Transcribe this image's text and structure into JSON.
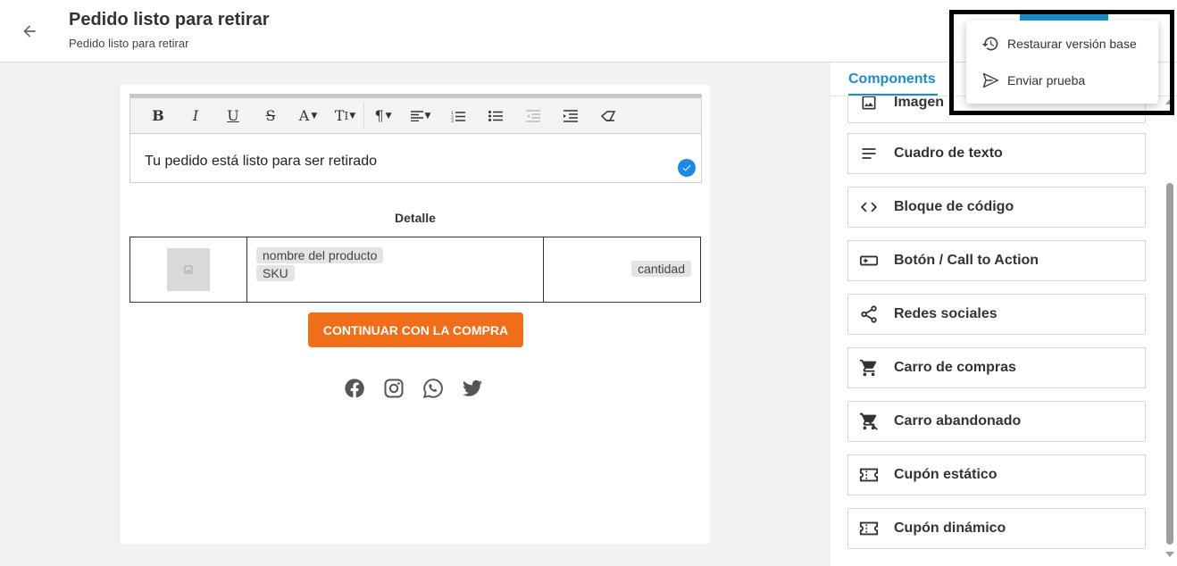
{
  "header": {
    "title": "Pedido listo para retirar",
    "subtitle": "Pedido listo para retirar"
  },
  "editor": {
    "toolbar": [
      "B",
      "I",
      "U",
      "S",
      "A",
      "T",
      "¶"
    ],
    "text": "Tu pedido está listo para ser retirado"
  },
  "email": {
    "detail_heading": "Detalle",
    "product_name": "nombre del producto",
    "sku": "SKU",
    "quantity": "cantidad",
    "cta_label": "CONTINUAR CON LA COMPRA",
    "social_icons": [
      "facebook-icon",
      "instagram-icon",
      "whatsapp-icon",
      "twitter-icon"
    ]
  },
  "panel": {
    "tab_label": "Components",
    "items": [
      {
        "label": "Imagen",
        "icon": "image-icon"
      },
      {
        "label": "Cuadro de texto",
        "icon": "text-lines-icon"
      },
      {
        "label": "Bloque de código",
        "icon": "code-icon"
      },
      {
        "label": "Botón / Call to Action",
        "icon": "button-icon"
      },
      {
        "label": "Redes sociales",
        "icon": "share-icon"
      },
      {
        "label": "Carro de compras",
        "icon": "cart-icon"
      },
      {
        "label": "Carro abandonado",
        "icon": "cart-off-icon"
      },
      {
        "label": "Cupón estático",
        "icon": "coupon-icon"
      },
      {
        "label": "Cupón dinámico",
        "icon": "coupon-icon"
      }
    ]
  },
  "menu": {
    "restore_label": "Restaurar versión base",
    "send_test_label": "Enviar prueba"
  },
  "colors": {
    "accent": "#1c8ec9",
    "cta": "#f06d1a"
  }
}
